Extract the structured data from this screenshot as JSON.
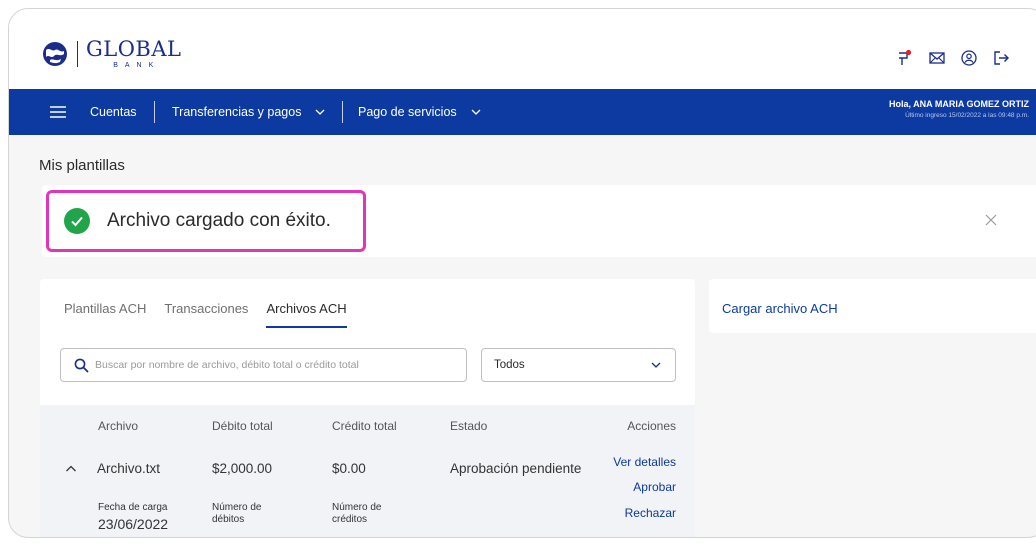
{
  "brand": {
    "name": "GLOBAL",
    "sub": "BANK"
  },
  "colors": {
    "primary": "#0c3aa0",
    "success": "#21a54b",
    "highlight": "#e236b8",
    "flag_dot": "#e0212e"
  },
  "header_icons": [
    "flag-icon",
    "mail-icon",
    "user-circle-icon",
    "logout-icon"
  ],
  "nav": {
    "menu_icon": "hamburger-icon",
    "items": [
      {
        "label": "Cuentas"
      },
      {
        "label": "Transferencias y pagos",
        "has_dropdown": true
      },
      {
        "label": "Pago de servicios",
        "has_dropdown": true
      }
    ],
    "user_greeting": "Hola, ANA MARIA GOMEZ ORTIZ",
    "last_login": "Último ingreso 15/02/2022 a las 09:48 p.m."
  },
  "page": {
    "title": "Mis plantillas"
  },
  "alert": {
    "message": "Archivo cargado con éxito.",
    "icon": "check-circle-icon",
    "close_icon": "close-icon"
  },
  "tabs": [
    {
      "label": "Plantillas ACH",
      "active": false
    },
    {
      "label": "Transacciones",
      "active": false
    },
    {
      "label": "Archivos ACH",
      "active": true
    }
  ],
  "search": {
    "placeholder": "Buscar por nombre de archivo, débito total o crédito total",
    "value": ""
  },
  "filter": {
    "selected": "Todos"
  },
  "table": {
    "headers": {
      "archivo": "Archivo",
      "debito": "Débito total",
      "credito": "Crédito total",
      "estado": "Estado",
      "acciones": "Acciones"
    },
    "row": {
      "archivo": "Archivo.txt",
      "debito": "$2,000.00",
      "credito": "$0.00",
      "estado": "Aprobación pendiente",
      "actions": [
        "Ver detalles",
        "Aprobar",
        "Rechazar"
      ],
      "details": {
        "fecha_label": "Fecha de carga",
        "fecha_value": "23/06/2022",
        "num_debitos_label_1": "Número de",
        "num_debitos_label_2": "débitos",
        "num_creditos_label_1": "Número de",
        "num_creditos_label_2": "créditos"
      }
    }
  },
  "side": {
    "link": "Cargar archivo ACH"
  }
}
